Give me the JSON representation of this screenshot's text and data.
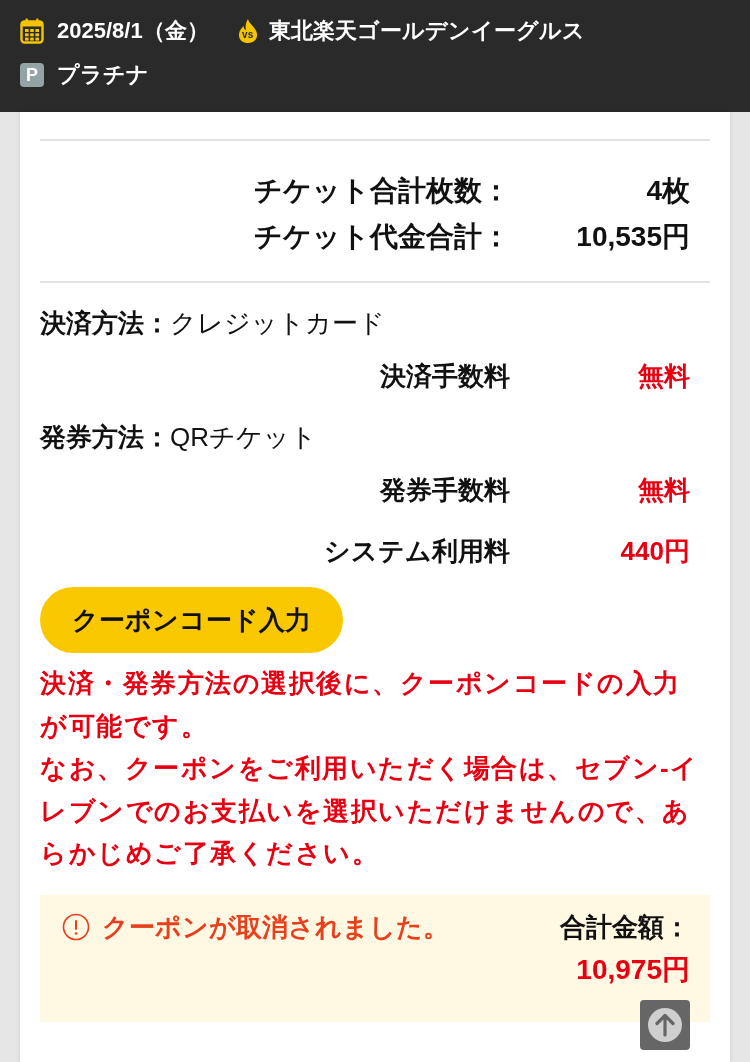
{
  "header": {
    "date": "2025/8/1（金）",
    "versus_mark": "vs",
    "opponent": "東北楽天ゴールデンイーグルス",
    "seat_mark": "P",
    "seat_grade": "プラチナ"
  },
  "ticket_totals": [
    {
      "label": "チケット合計枚数：",
      "value": "4枚"
    },
    {
      "label": "チケット代金合計：",
      "value": "10,535円"
    }
  ],
  "payment": [
    {
      "kind": "method",
      "label": "決済方法：",
      "value": "クレジットカード"
    },
    {
      "kind": "fee",
      "label": "決済手数料",
      "value": "無料"
    },
    {
      "kind": "method",
      "label": "発券方法：",
      "value": "QRチケット"
    },
    {
      "kind": "fee",
      "label": "発券手数料",
      "value": "無料"
    },
    {
      "kind": "fee",
      "label": "システム利用料",
      "value": "440円"
    }
  ],
  "coupon_button": "クーポンコード入力",
  "coupon_notice": [
    "決済・発券方法の選択後に、クーポンコードの入力が可能です。",
    "なお、クーポンをご利用いただく場合は、セブン-イレブンでのお支払いを選択いただけませんので、あらかじめご了承ください。"
  ],
  "summary": {
    "alert": "クーポンが取消されました。",
    "total_label": "合計金額：",
    "total_value": "10,975円"
  }
}
